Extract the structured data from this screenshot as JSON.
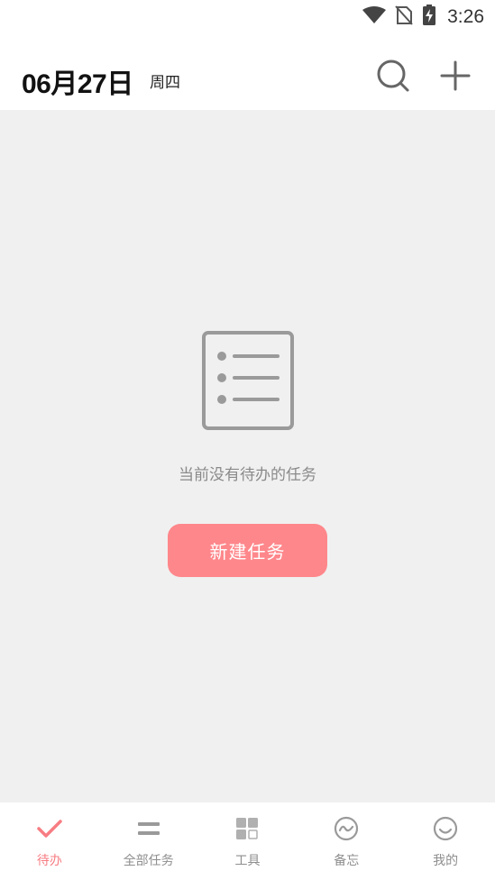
{
  "status_bar": {
    "time": "3:26",
    "icons": [
      "wifi-icon",
      "no-sim-icon",
      "battery-charging-icon"
    ]
  },
  "header": {
    "date": "06月27日",
    "weekday": "周四",
    "actions": [
      "search-icon",
      "add-icon"
    ]
  },
  "empty_state": {
    "icon": "list-document-icon",
    "message": "当前没有待办的任务",
    "button_label": "新建任务"
  },
  "tabbar": {
    "items": [
      {
        "label": "待办",
        "icon": "check-icon",
        "active": true
      },
      {
        "label": "全部任务",
        "icon": "menu-lines-icon",
        "active": false
      },
      {
        "label": "工具",
        "icon": "grid-icon",
        "active": false
      },
      {
        "label": "备忘",
        "icon": "memo-wave-icon",
        "active": false
      },
      {
        "label": "我的",
        "icon": "smile-face-icon",
        "active": false
      }
    ]
  },
  "colors": {
    "accent": "#fe878b",
    "tab_active": "#f77d83",
    "background": "#f0f0f0",
    "icon_gray": "#9a9a9a"
  }
}
